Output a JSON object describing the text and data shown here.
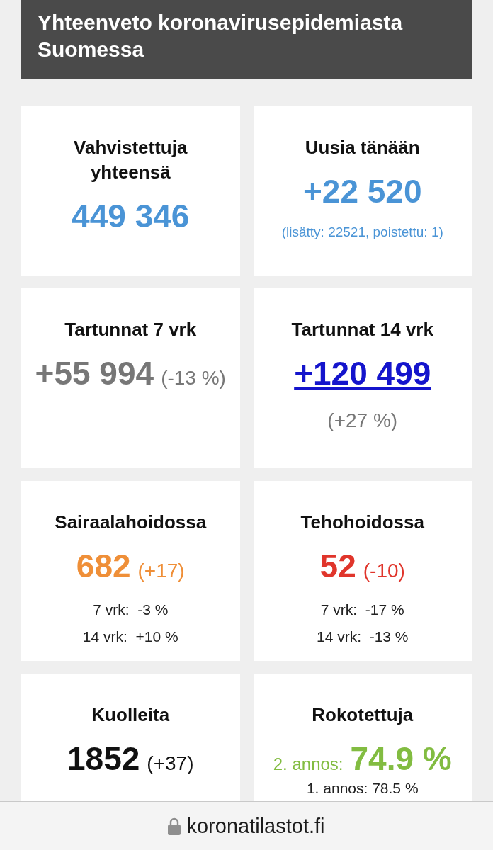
{
  "header": {
    "title": "Yhteenveto koronavirusepidemiasta Suomessa"
  },
  "cards": [
    {
      "kind": "stat",
      "title": "Vahvistettuja yhteensä",
      "value": "449 346",
      "color": "#4a94d6"
    },
    {
      "kind": "stat",
      "title": "Uusia tänään",
      "value": "+22 520",
      "color": "#4a94d6",
      "note": "(lisätty: 22521, poistettu: 1)"
    },
    {
      "kind": "stat",
      "title": "Tartunnat 7 vrk",
      "value": "+55 994",
      "change": "(-13 %)",
      "color": "#777777"
    },
    {
      "kind": "link",
      "title": "Tartunnat 14 vrk",
      "value": "+120 499",
      "color": "#1414cc",
      "note": "(+27 %)"
    },
    {
      "kind": "stat",
      "title": "Sairaalahoidossa",
      "value": "682",
      "change": "(+17)",
      "color": "#ef8f38",
      "lines": [
        "7 vrk:  -3 %",
        "14 vrk:  +10 %"
      ]
    },
    {
      "kind": "stat",
      "title": "Tehohoidossa",
      "value": "52",
      "change": "(-10)",
      "color": "#e0352b",
      "lines": [
        "7 vrk:  -17 %",
        "14 vrk:  -13 %"
      ]
    },
    {
      "kind": "stat",
      "title": "Kuolleita",
      "value": "1852",
      "change": "(+37)",
      "color": "#111111"
    },
    {
      "kind": "dose",
      "title": "Rokotettuja",
      "prefix": "2. annos:",
      "value": "74.9 %",
      "color": "#82bc41",
      "lines": [
        "1. annos: 78.5 %"
      ]
    }
  ],
  "address_bar": {
    "url": "koronatilastot.fi"
  }
}
